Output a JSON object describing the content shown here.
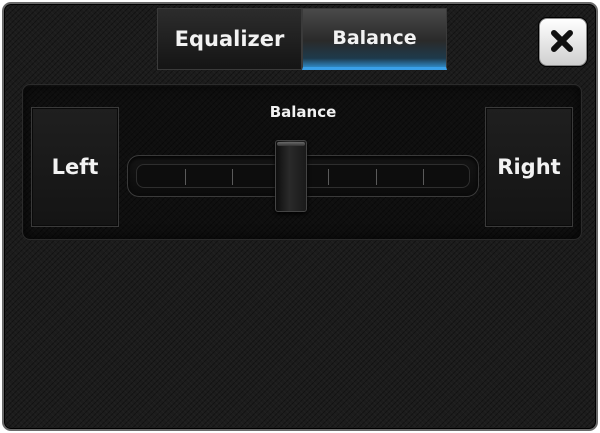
{
  "tabs": {
    "equalizer": "Equalizer",
    "balance": "Balance",
    "active": "balance"
  },
  "close": {
    "icon": "close-icon"
  },
  "balance_panel": {
    "slider_label": "Balance",
    "left_label": "Left",
    "right_label": "Right",
    "value_fraction": 0.47,
    "tick_count": 6
  },
  "colors": {
    "accent": "#3aa0e8",
    "background": "#1c1c1c",
    "text": "#f2f2f2"
  }
}
